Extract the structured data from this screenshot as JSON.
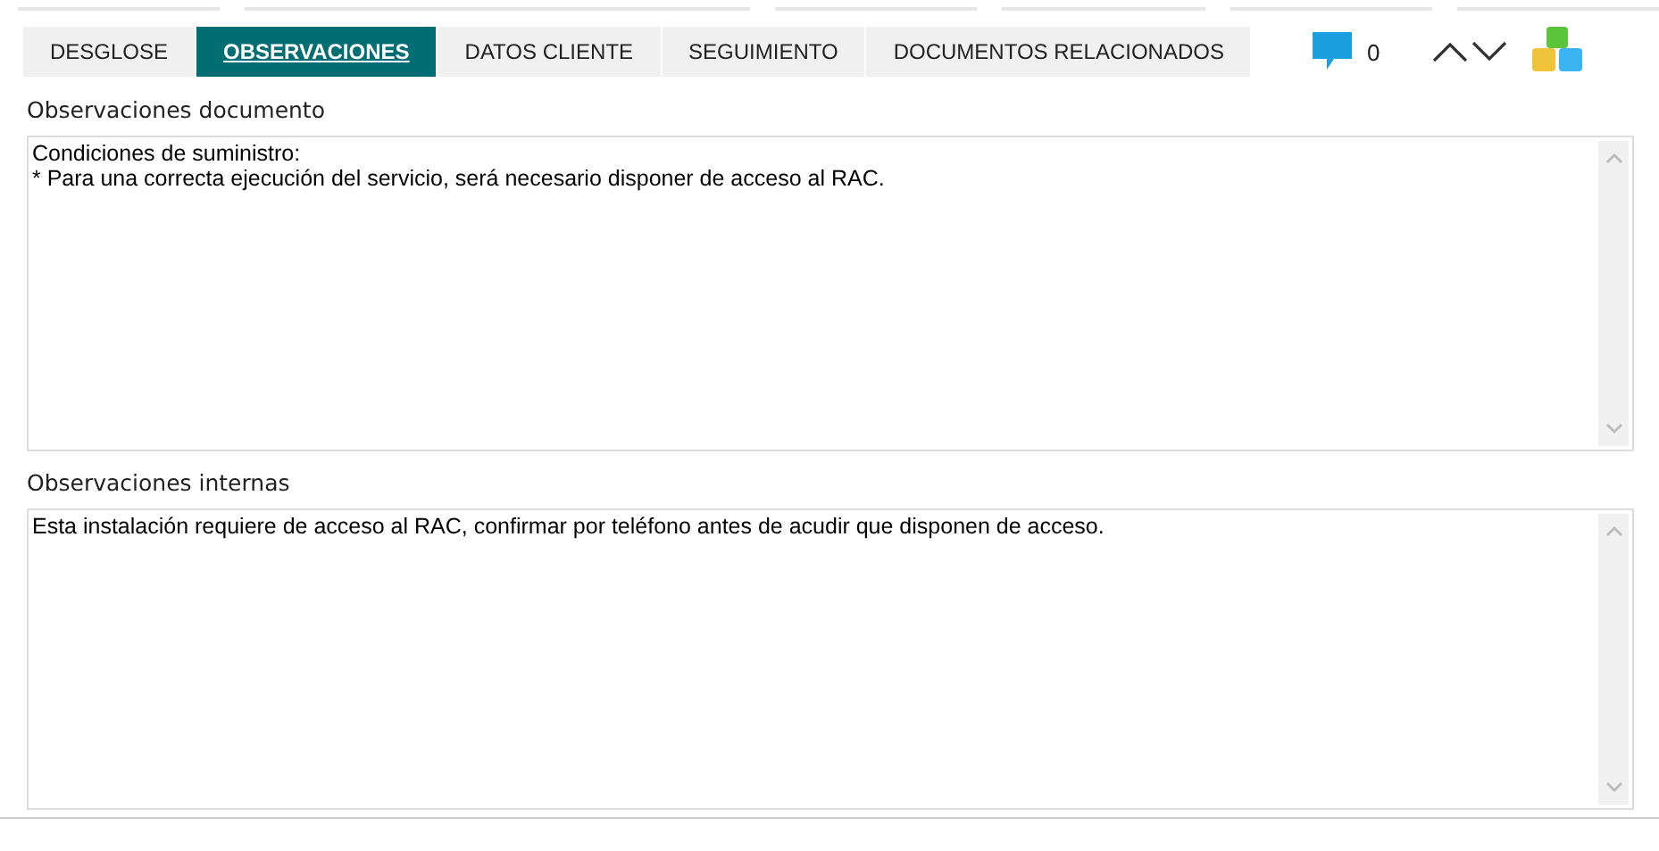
{
  "tabs": [
    {
      "label": "DESGLOSE",
      "selected": false
    },
    {
      "label": "OBSERVACIONES",
      "selected": true
    },
    {
      "label": "DATOS CLIENTE",
      "selected": false
    },
    {
      "label": "SEGUIMIENTO",
      "selected": false
    },
    {
      "label": "DOCUMENTOS RELACIONADOS",
      "selected": false
    }
  ],
  "toolbar": {
    "comment_count": "0"
  },
  "sections": [
    {
      "label": "Observaciones documento",
      "lines": [
        "Condiciones de suministro:",
        "* Para una correcta ejecución del servicio, será necesario disponer de acceso al RAC."
      ]
    },
    {
      "label": "Observaciones internas",
      "lines": [
        "Esta instalación requiere de acceso al RAC, confirmar por teléfono antes de acudir que disponen de acceso."
      ]
    }
  ]
}
